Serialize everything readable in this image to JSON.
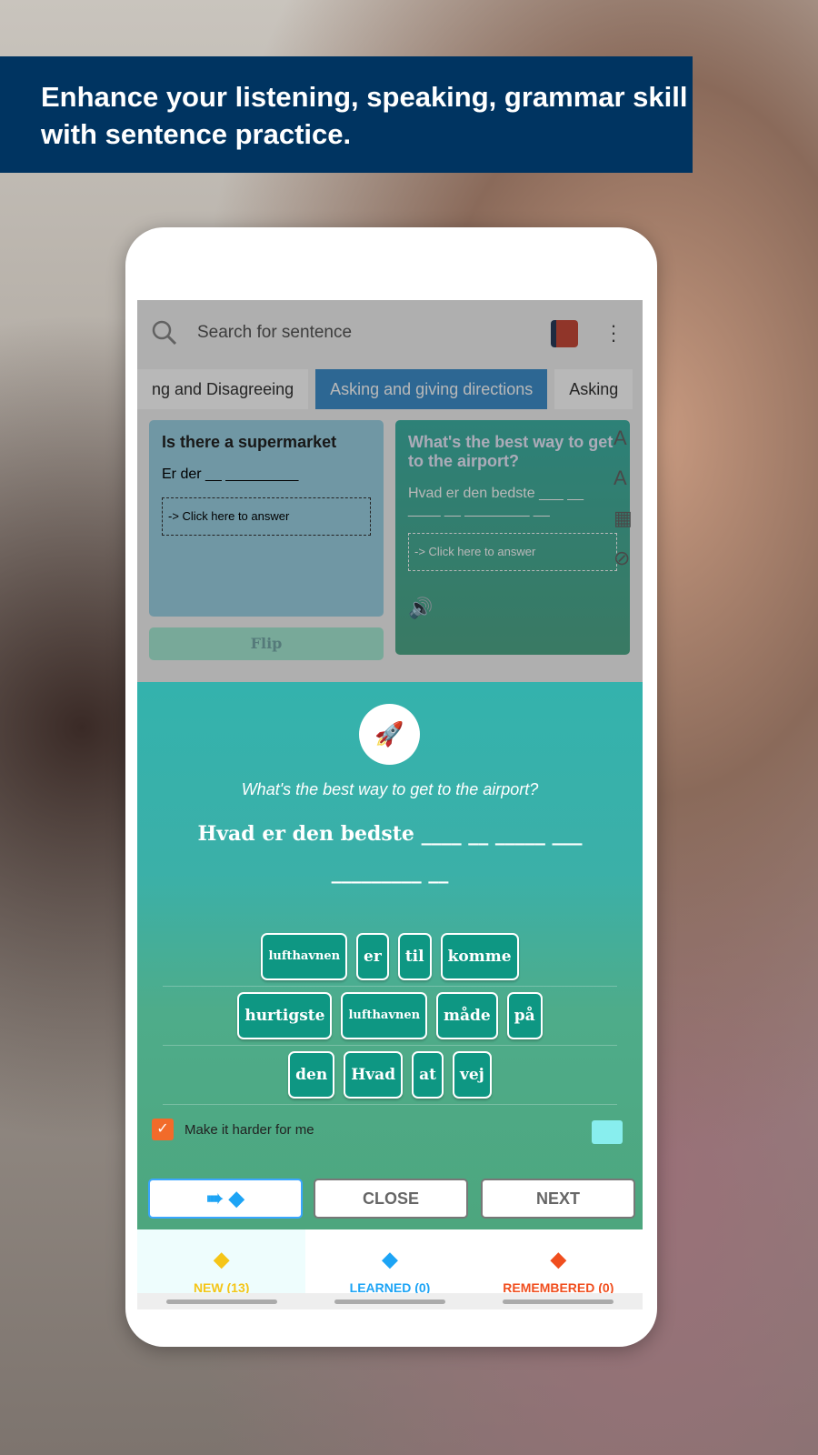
{
  "banner": {
    "text": "Enhance your listening, speaking, grammar skill with sentence practice."
  },
  "search": {
    "placeholder": "Search for sentence",
    "icon": "search-icon",
    "book_icon": "books-icon",
    "menu_icon": "more-vertical-icon"
  },
  "tabs": [
    {
      "label": "ng and Disagreeing"
    },
    {
      "label": "Asking and giving directions",
      "active": true
    },
    {
      "label": "Asking"
    }
  ],
  "cards": [
    {
      "title": "Is there a  supermarket",
      "blank": "Er der __ _________",
      "answer": "-> Click here to answer",
      "flip": "Flip"
    },
    {
      "title": "What's the best way to get to  the airport?",
      "blank": "Hvad er den bedste ___ __ ____ __ ________ __",
      "answer": "-> Click here to answer"
    }
  ],
  "dialog": {
    "question": "What's the best way to get to  the airport?",
    "sentence": "Hvad er den bedste ____ __ _____ ___ _________ __",
    "rows": [
      [
        "lufthavnen",
        "er",
        "til",
        "komme"
      ],
      [
        "hurtigste",
        "lufthavnen",
        "måde",
        "på"
      ],
      [
        "den",
        "Hvad",
        "at",
        "vej"
      ]
    ],
    "harder_label": "Make it harder for me",
    "harder_checked": true,
    "close": "CLOSE",
    "next": "NEXT"
  },
  "bottom_tabs": [
    {
      "label": "NEW (13)",
      "color": "#f5c518"
    },
    {
      "label": "LEARNED (0)",
      "color": "#1da4f5"
    },
    {
      "label": "REMEMBERED (0)",
      "color": "#f04e1e"
    }
  ]
}
